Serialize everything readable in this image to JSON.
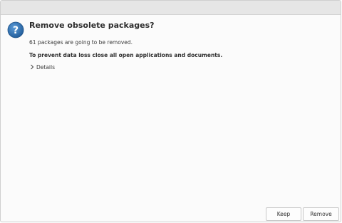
{
  "dialog": {
    "title": "Remove obsolete packages?",
    "message": "61 packages are going to be removed.",
    "warning": "To prevent data loss close all open applications and documents.",
    "details_label": "Details",
    "icon": "question-icon"
  },
  "buttons": {
    "keep_label": "Keep",
    "remove_label": "Remove"
  },
  "colors": {
    "icon_blue": "#2a6aa8",
    "titlebar": "#e6e6e6",
    "background": "#fbfbfb"
  }
}
